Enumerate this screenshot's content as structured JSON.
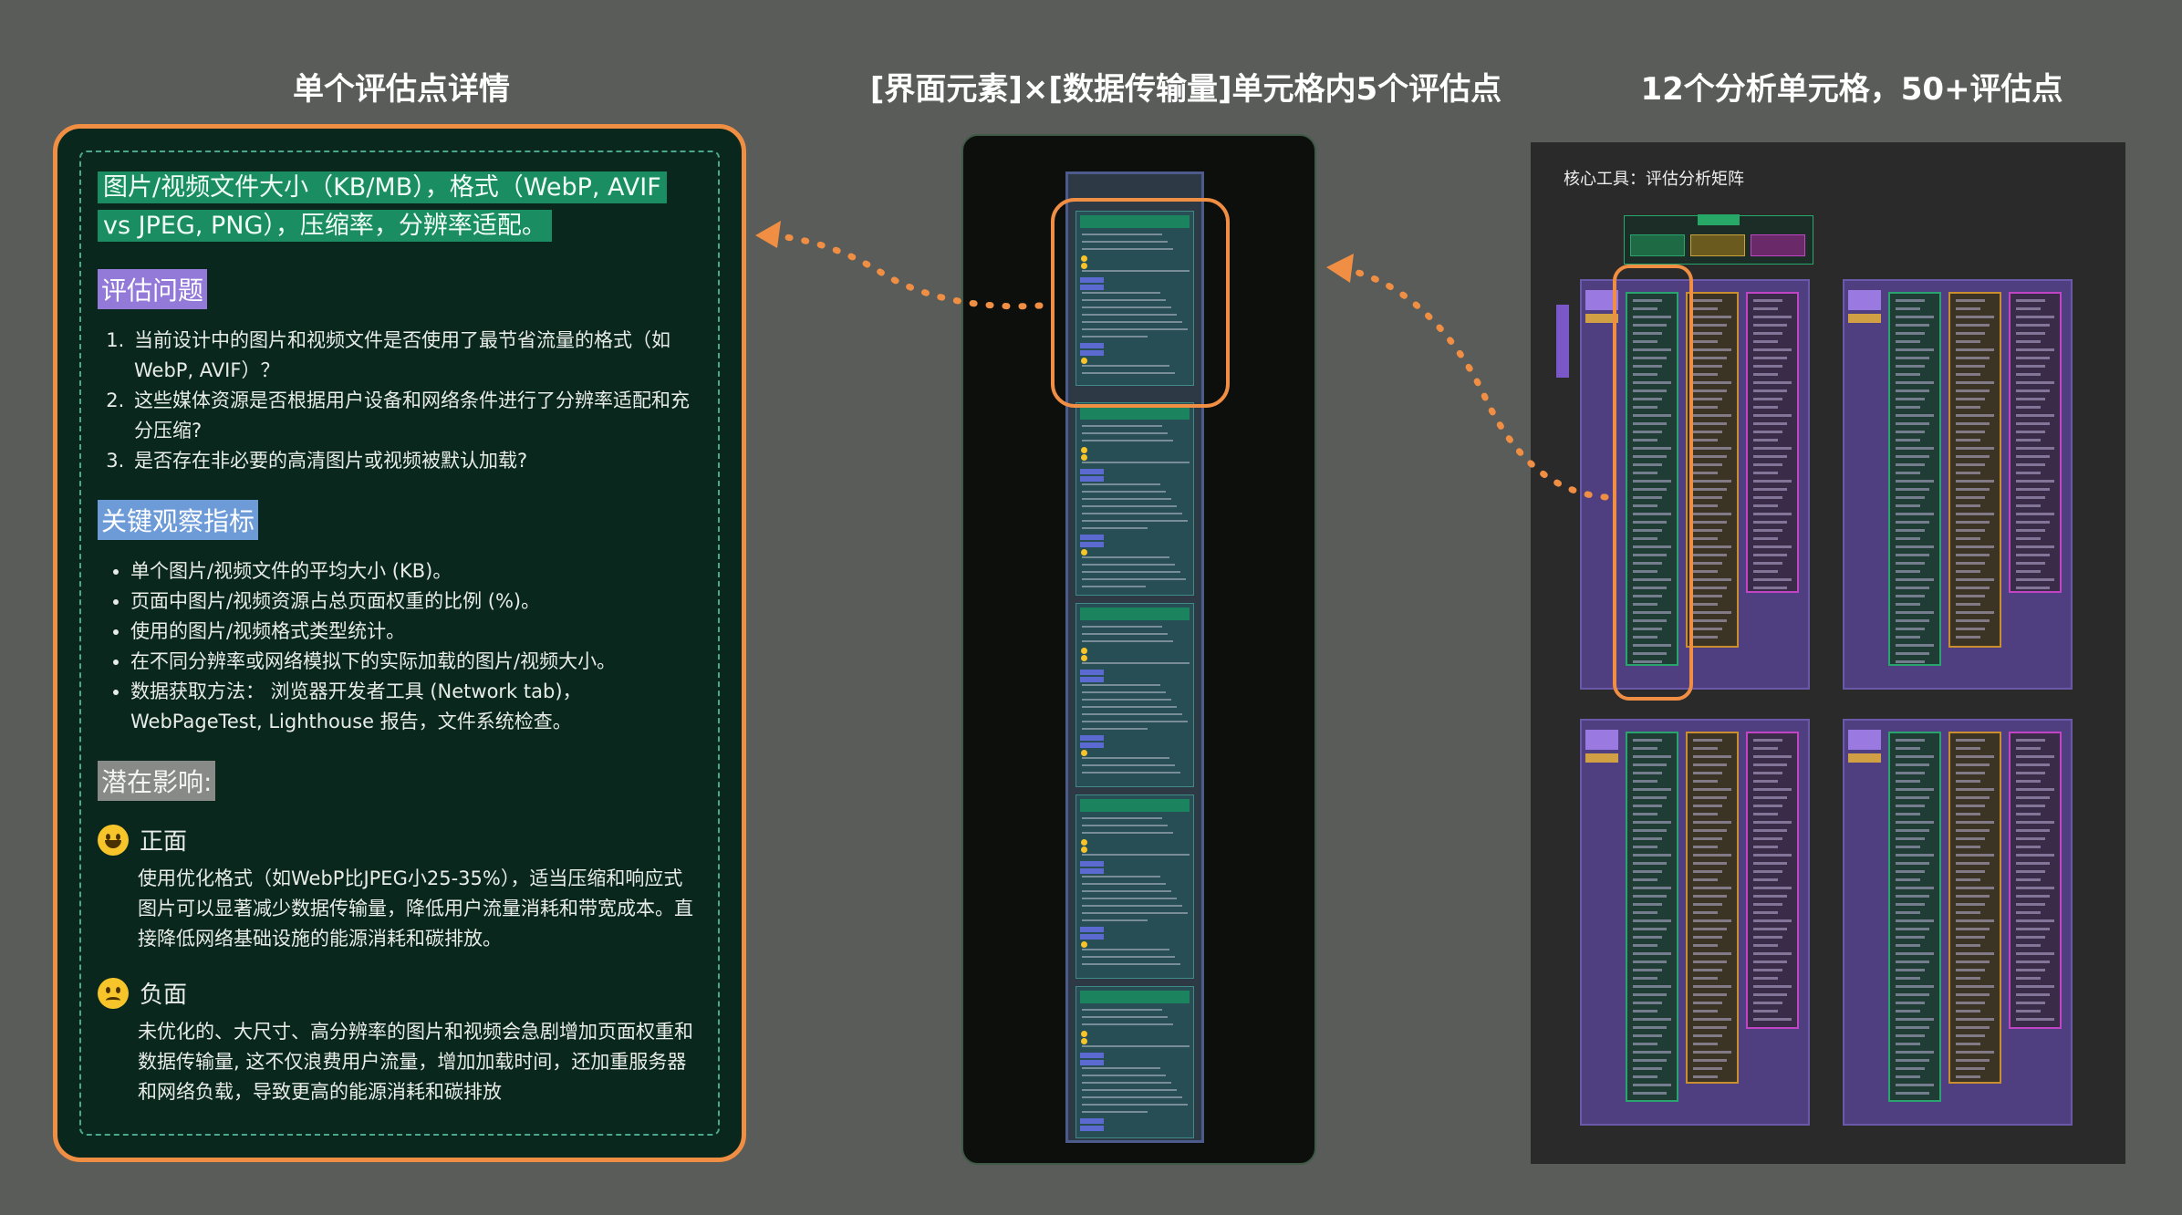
{
  "titles": {
    "left": "单个评估点详情",
    "middle": "[界面元素]×[数据传输量]单元格内5个评估点",
    "right": "12个分析单元格，50+评估点"
  },
  "detail": {
    "heading": "图片/视频文件大小（KB/MB），格式（WebP, AVIF vs JPEG, PNG），压缩率，分辨率适配。",
    "questions_label": "评估问题",
    "questions": [
      "当前设计中的图片和视频文件是否使用了最节省流量的格式（如WebP, AVIF）？",
      "这些媒体资源是否根据用户设备和网络条件进行了分辨率适配和充分压缩?",
      "是否存在非必要的高清图片或视频被默认加载?"
    ],
    "metrics_label": "关键观察指标",
    "metrics": [
      "单个图片/视频文件的平均大小 (KB)。",
      "页面中图片/视频资源占总页面权重的比例 (%)。",
      "使用的图片/视频格式类型统计。",
      "在不同分辨率或网络模拟下的实际加载的图片/视频大小。",
      "数据获取方法： 浏览器开发者工具 (Network tab)，WebPageTest, Lighthouse 报告，文件系统检查。"
    ],
    "impact_label": "潜在影响:",
    "positive_label": "正面",
    "positive_text": "使用优化格式（如WebP比JPEG小25-35%），适当压缩和响应式图片可以显著减少数据传输量，降低用户流量消耗和带宽成本。直接降低网络基础设施的能源消耗和碳排放。",
    "negative_label": "负面",
    "negative_text": "未优化的、大尺寸、高分辨率的图片和视频会急剧增加页面权重和数据传输量, 这不仅浪费用户流量，增加加载时间，还加重服务器和网络负载，导致更高的能源消耗和碳排放"
  },
  "matrix": {
    "tool_label": "核心工具：评估分析矩阵"
  },
  "colors": {
    "background": "#595c59",
    "accent_orange": "#f08f44",
    "panel_dark_green": "#0a271e",
    "highlight_green": "#1a8d62",
    "purple": "#9379d8",
    "blue": "#6d9bd8"
  }
}
